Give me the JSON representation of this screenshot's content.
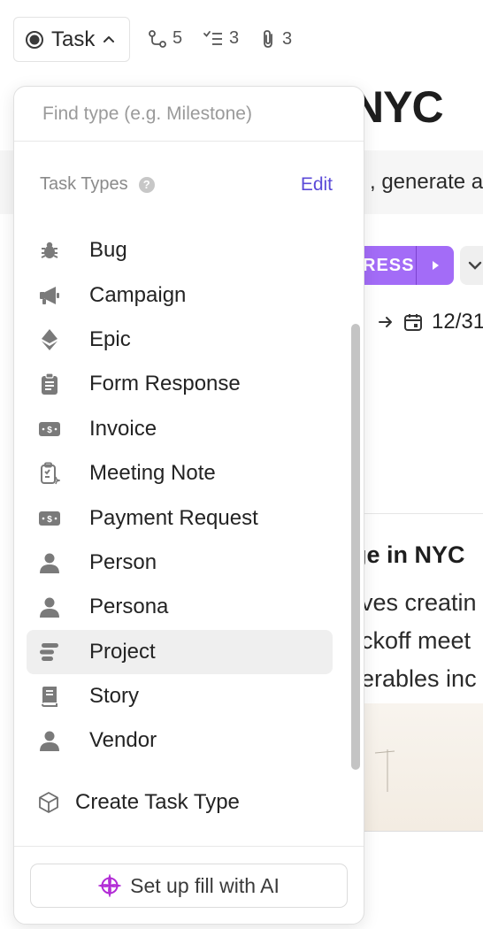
{
  "toolbar": {
    "task_label": "Task",
    "subtasks_count": "5",
    "checklist_count": "3",
    "attachments_count": "3"
  },
  "background": {
    "title": "NYC",
    "strip_text": ", generate a",
    "status_label": "RESS",
    "date_text": "12/31",
    "heading": "ge in NYC",
    "para_lines": [
      "ves creatin",
      "ckoff meet",
      "erables inc"
    ]
  },
  "dropdown": {
    "search_placeholder": "Find type (e.g. Milestone)",
    "section_title": "Task Types",
    "help_symbol": "?",
    "edit_label": "Edit",
    "types": [
      {
        "label": "Bug",
        "icon": "bug-icon"
      },
      {
        "label": "Campaign",
        "icon": "megaphone-icon"
      },
      {
        "label": "Epic",
        "icon": "epic-icon"
      },
      {
        "label": "Form Response",
        "icon": "clipboard-icon"
      },
      {
        "label": "Invoice",
        "icon": "invoice-icon"
      },
      {
        "label": "Meeting Note",
        "icon": "meeting-note-icon"
      },
      {
        "label": "Payment Request",
        "icon": "payment-icon"
      },
      {
        "label": "Person",
        "icon": "person-icon"
      },
      {
        "label": "Persona",
        "icon": "persona-icon"
      },
      {
        "label": "Project",
        "icon": "project-icon",
        "active": true
      },
      {
        "label": "Story",
        "icon": "book-icon"
      },
      {
        "label": "Vendor",
        "icon": "vendor-icon"
      }
    ],
    "create_label": "Create Task Type",
    "ai_label": "Set up fill with AI"
  },
  "colors": {
    "accent": "#5b4ad8",
    "status": "#a36cf7",
    "ai_icon": "#b22bd6",
    "icon_gray": "#7a7a7a"
  }
}
